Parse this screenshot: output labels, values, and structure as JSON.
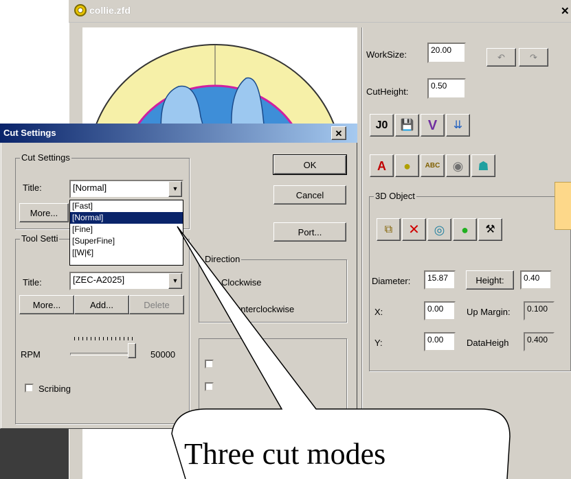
{
  "main_window": {
    "title": "collie.zfd",
    "close_glyph": "✕",
    "worksize_label": "WorkSize:",
    "worksize_value": "20.00",
    "cutheight_label": "CutHeight:",
    "cutheight_value": "0.50",
    "undo_icon": "undo-icon",
    "redo_icon": "redo-icon",
    "object_group": {
      "title": "3D Object",
      "diameter_label": "Diameter:",
      "diameter_value": "15.87",
      "height_button": "Height:",
      "height_value": "0.40",
      "x_label": "X:",
      "x_value": "0.00",
      "up_margin_label": "Up Margin:",
      "up_margin_value": "0.100",
      "y_label": "Y:",
      "y_value": "0.00",
      "data_height_label": "DataHeigh",
      "data_height_value": "0.400"
    }
  },
  "dialog": {
    "title": "Cut Settings",
    "close_glyph": "✕",
    "ok_label": "OK",
    "cancel_label": "Cancel",
    "port_label": "Port...",
    "cut_group": {
      "title": "Cut Settings",
      "title_label": "Title:",
      "selected": "[Normal]",
      "more_label": "More..."
    },
    "dropdown_options": [
      "[Fast]",
      "[Normal]",
      "[Fine]",
      "[SuperFine]",
      "[[W|€]"
    ],
    "tool_group": {
      "title": "Tool Setti",
      "title_label": "Title:",
      "selected": "[ZEC-A2025]",
      "more_label": "More...",
      "add_label": "Add...",
      "delete_label": "Delete",
      "rpm_label": "RPM",
      "rpm_value": "50000",
      "rpm_level": 1.0,
      "scribing_label": "Scribing"
    },
    "direction_group": {
      "title": "Direction",
      "clockwise": "Clockwise",
      "counterclockwise": "unterclockwise"
    }
  },
  "callout": {
    "text": "Three cut modes"
  },
  "colors": {
    "dialog_title_start": "#0a246a",
    "dialog_title_end": "#a6caf0",
    "selection": "#0a246a",
    "model_blue": "#3e8ed8",
    "ring_yellow": "#f6f0a8",
    "outline_magenta": "#d020a0"
  }
}
